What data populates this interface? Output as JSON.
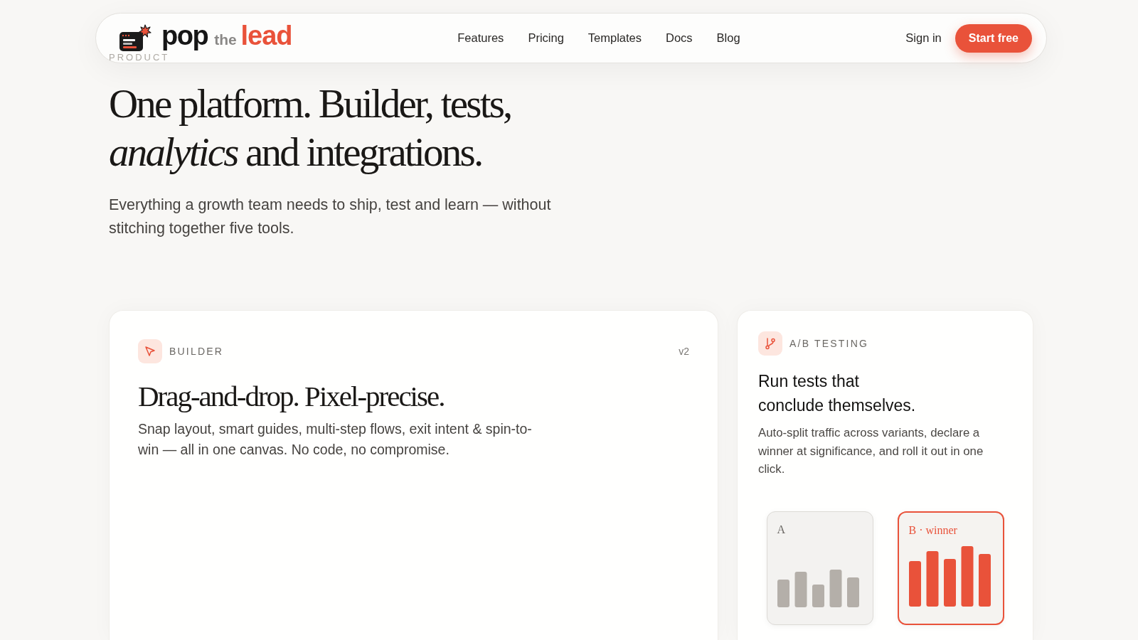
{
  "nav": {
    "logo": {
      "words": [
        {
          "text": "pop",
          "kind": "main"
        },
        {
          "text": "the",
          "kind": "small"
        },
        {
          "text": "lead",
          "kind": "accent"
        }
      ]
    },
    "links": [
      "Features",
      "Pricing",
      "Templates",
      "Docs",
      "Blog"
    ],
    "sign_in": "Sign in",
    "cta": "Start free"
  },
  "hero": {
    "eyebrow": "PRODUCT",
    "title_lines": [
      "One platform. Builder, tests,",
      "*analytics* and integrations."
    ],
    "subtitle": "Everything a growth team needs to ship, test and learn — without stitching together five tools."
  },
  "cards": [
    {
      "kind": "builder",
      "label": "BUILDER",
      "badge": "v2",
      "title_lines": [
        "Drag-and-drop. Pixel-precise."
      ],
      "description": "Snap layout, smart guides, multi-step flows, exit intent & spin-to-win — all in one canvas. No code, no compromise."
    },
    {
      "kind": "ab_testing",
      "label": "A/B TESTING",
      "title_lines": [
        "Run tests that",
        "conclude themselves."
      ],
      "description": "Auto-split traffic across variants, declare a winner at significance, and roll it out in one click.",
      "variants": [
        {
          "label": "A",
          "winner": false
        },
        {
          "label": "B · winner",
          "winner": true
        }
      ]
    }
  ]
}
